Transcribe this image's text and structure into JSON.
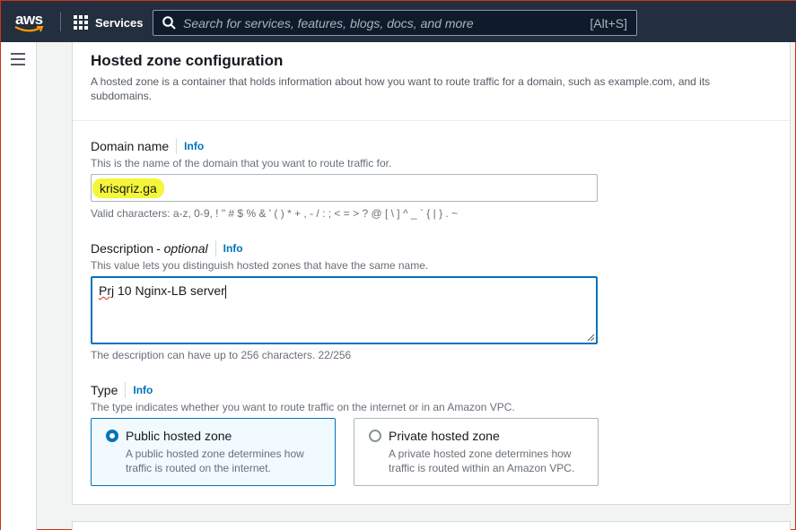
{
  "nav": {
    "logo": "aws",
    "services_label": "Services",
    "search_placeholder": "Search for services, features, blogs, docs, and more",
    "search_shortcut": "[Alt+S]"
  },
  "panel": {
    "title": "Hosted zone configuration",
    "description": "A hosted zone is a container that holds information about how you want to route traffic for a domain, such as example.com, and its subdomains."
  },
  "domain": {
    "label": "Domain name",
    "info": "Info",
    "hint": "This is the name of the domain that you want to route traffic for.",
    "value": "krisqriz.ga",
    "constraint": "Valid characters: a-z, 0-9, ! \" # $ % & ' ( ) * + , - / : ; < = > ? @ [ \\ ] ^ _ ` { | } . ~"
  },
  "description_field": {
    "label": "Description",
    "optional": "- optional",
    "info": "Info",
    "hint": "This value lets you distinguish hosted zones that have the same name.",
    "value_prefix": "Prj",
    "value_rest": " 10 Nginx-LB server",
    "constraint": "The description can have up to 256 characters. 22/256"
  },
  "type": {
    "label": "Type",
    "info": "Info",
    "hint": "The type indicates whether you want to route traffic on the internet or in an Amazon VPC.",
    "options": [
      {
        "title": "Public hosted zone",
        "desc": "A public hosted zone determines how traffic is routed on the internet.",
        "selected": true
      },
      {
        "title": "Private hosted zone",
        "desc": "A private hosted zone determines how traffic is routed within an Amazon VPC.",
        "selected": false
      }
    ]
  },
  "colors": {
    "nav_bg": "#232f3e",
    "link": "#0073bb",
    "highlight": "#f5f53a",
    "selected_tile_bg": "#f1faff"
  }
}
